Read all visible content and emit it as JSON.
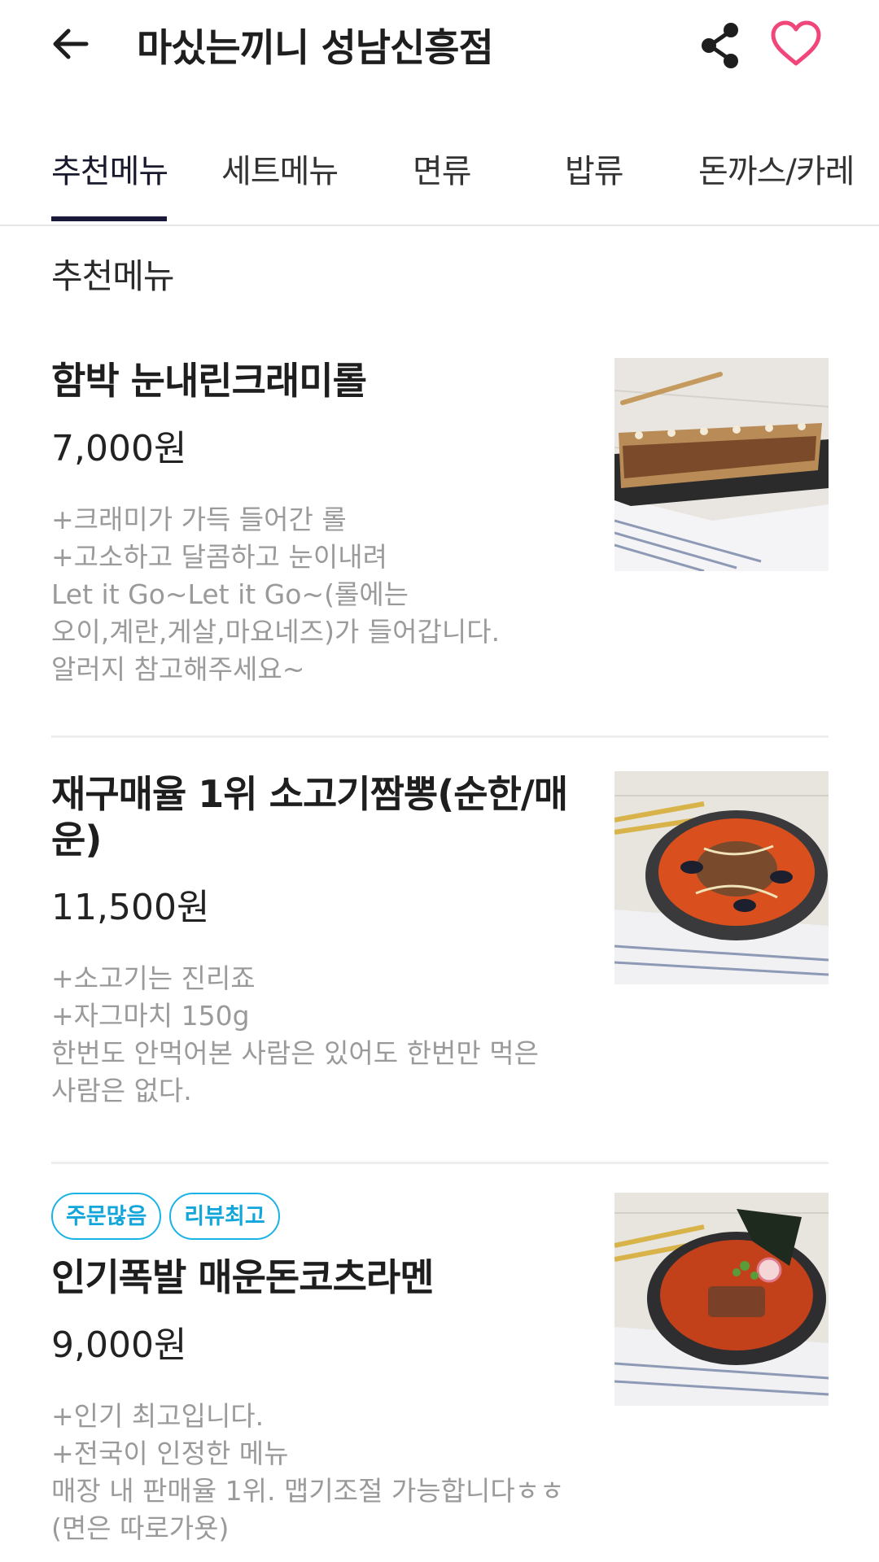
{
  "header": {
    "title": "마싰는끼니 성남신흥점",
    "back_icon": "arrow-left-icon",
    "share_icon": "share-icon",
    "favorite_icon": "heart-outline-icon",
    "favorite_color": "#F0467A"
  },
  "tabs": [
    {
      "label": "추천메뉴",
      "active": true
    },
    {
      "label": "세트메뉴",
      "active": false
    },
    {
      "label": "면류",
      "active": false
    },
    {
      "label": "밥류",
      "active": false
    },
    {
      "label": "돈까스/카레",
      "active": false
    }
  ],
  "section": {
    "title": "추천메뉴"
  },
  "menu_items": [
    {
      "name": "함박 눈내린크래미롤",
      "price": "7,000원",
      "description": "+크래미가 가득 들어간 롤\n+고소하고 달콤하고 눈이내려\nLet it Go~Let it Go~(롤에는\n오이,계란,게살,마요네즈)가 들어갑니다.\n알러지 참고해주세요~",
      "badges": [],
      "photo": "roll-photo"
    },
    {
      "name": "재구매율 1위 소고기짬뽕(순한/매운)",
      "price": "11,500원",
      "description": "+소고기는 진리죠\n+자그마치 150g\n한번도 안먹어본 사람은 있어도 한번만 먹은\n사람은 없다.",
      "badges": [],
      "photo": "jjamppong-photo"
    },
    {
      "name": "인기폭발 매운돈코츠라멘",
      "price": "9,000원",
      "description": "+인기 최고입니다.\n+전국이 인정한 메뉴\n매장 내 판매율 1위. 맵기조절 가능합니다ㅎㅎ\n(면은 따로가욧)",
      "badges": [
        "주문많음",
        "리뷰최고"
      ],
      "photo": "ramen-photo"
    }
  ],
  "colors": {
    "accent_badge": "#1AB3E6",
    "tab_indicator": "#1A1838",
    "description_text": "#9A9A9A"
  }
}
